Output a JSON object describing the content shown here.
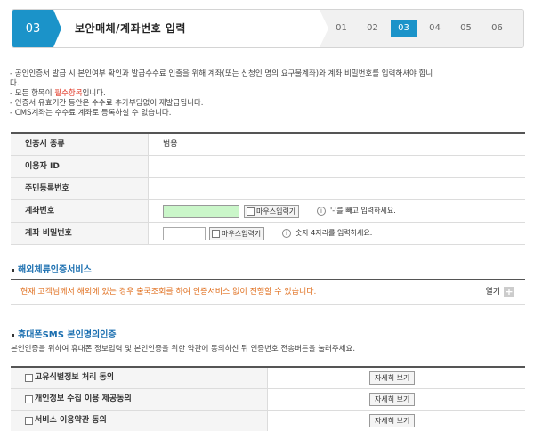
{
  "header": {
    "step_number": "03",
    "title": "보안매체/계좌번호 입력",
    "steps": [
      "01",
      "02",
      "03",
      "04",
      "05",
      "06"
    ],
    "active_step": "03"
  },
  "notes": {
    "line1": "- 공인인증서 발급 시 본인여부 확인과 발급수수료 인출을 위해 계좌(또는 신청인 명의 요구불계좌)와 계좌 비밀번호를 입력하셔야 합니",
    "line1b": "다.",
    "line2_prefix": "- 모든 항목이 ",
    "line2_required": "필수항목",
    "line2_suffix": "입니다.",
    "line3": "- 인증서 유효기간 동안은 수수료 추가부담없이 재발급됩니다.",
    "line4": "- CMS계좌는 수수료 계좌로 등록하실 수 없습니다."
  },
  "form": {
    "cert_type_label": "인증서 종류",
    "cert_type_value": "범용",
    "user_id_label": "이용자 ID",
    "user_id_value": "",
    "resident_no_label": "주민등록번호",
    "resident_no_value": "",
    "account_label": "계좌번호",
    "account_value": "",
    "account_mouse_label": "마우스입력기",
    "account_hint": "'-'를 빼고 입력하세요.",
    "password_label": "계좌 비밀번호",
    "password_value": "",
    "password_mouse_label": "마우스입력기",
    "password_hint": "숫자 4자리를 입력하세요."
  },
  "overseas": {
    "title": "해외체류인증서비스",
    "message": "현재 고객님께서 해외에 있는 경우 출국조회를 하여 인증서비스 없이 진행할 수 있습니다.",
    "open_label": "열기",
    "plus_icon": "+"
  },
  "sms": {
    "title": "휴대폰SMS 본인명의인증",
    "description": "본인인증을 위하여 휴대폰 정보입력 및 본인인증을 위한 약관에 동의하신 뒤 인증번호 전송버튼을 눌러주세요.",
    "agreements": [
      {
        "label": "고유식별정보 처리 동의",
        "button": "자세히 보기"
      },
      {
        "label": "개인정보 수집 이용 제공동의",
        "button": "자세히 보기"
      },
      {
        "label": "서비스 이용약관 동의",
        "button": "자세히 보기"
      }
    ]
  },
  "colors": {
    "accent": "#1b93c9",
    "required_text": "#e0301e",
    "section_title": "#1b6fb0",
    "warning_text": "#e07020",
    "account_input_bg": "#caf6c9"
  }
}
